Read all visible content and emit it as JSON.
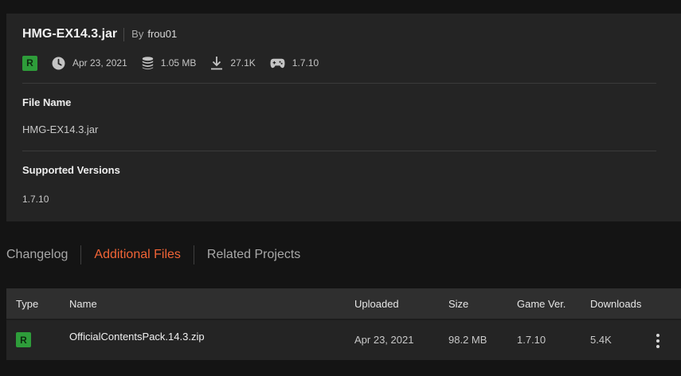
{
  "file": {
    "title": "HMG-EX14.3.jar",
    "by_label": "By",
    "author": "frou01",
    "release_badge": "R",
    "date": "Apr 23, 2021",
    "size": "1.05 MB",
    "downloads": "27.1K",
    "game_version": "1.7.10",
    "icons": [
      "clock-icon",
      "database-icon",
      "download-icon",
      "gamepad-icon"
    ]
  },
  "details": {
    "file_name_label": "File Name",
    "file_name_value": "HMG-EX14.3.jar",
    "supported_versions_label": "Supported Versions",
    "supported_versions_value": "1.7.10"
  },
  "tabs": [
    {
      "label": "Changelog",
      "active": false
    },
    {
      "label": "Additional Files",
      "active": true
    },
    {
      "label": "Related Projects",
      "active": false
    }
  ],
  "table": {
    "headers": [
      "Type",
      "Name",
      "Uploaded",
      "Size",
      "Game Ver.",
      "Downloads"
    ],
    "rows": [
      {
        "type": "R",
        "name": "OfficialContentsPack.14.3.zip",
        "uploaded": "Apr 23, 2021",
        "size": "98.2 MB",
        "game_version": "1.7.10",
        "downloads": "5.4K"
      }
    ]
  },
  "colors": {
    "accent": "#f16436",
    "release_badge": "#2e9d3a",
    "background": "#141414",
    "card": "#242424",
    "table_header": "#2f2f2f"
  }
}
